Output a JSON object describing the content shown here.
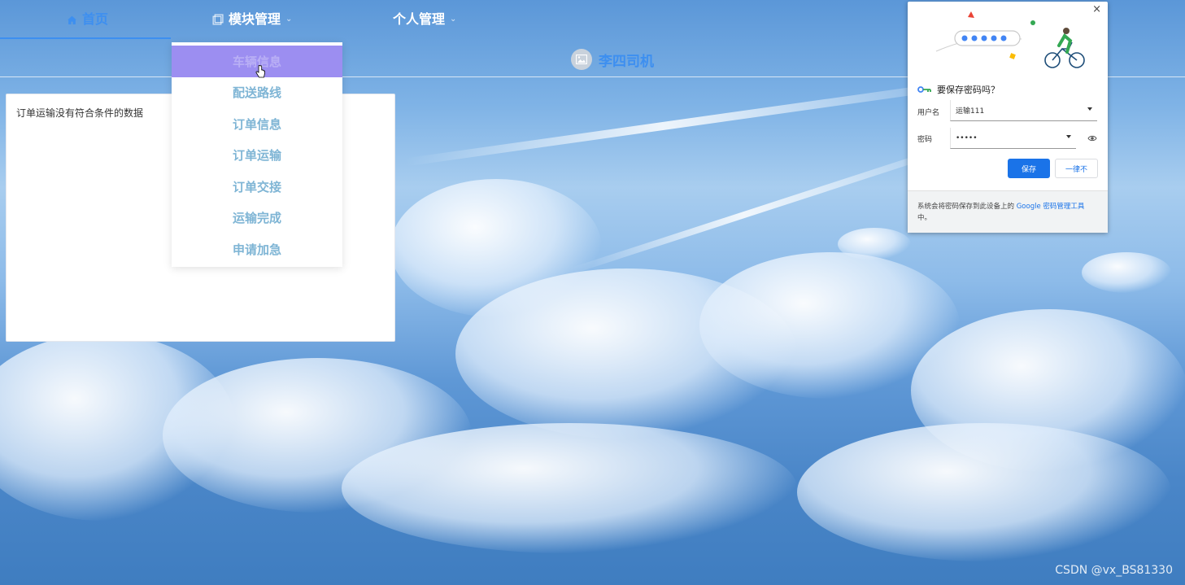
{
  "nav": {
    "home": "首页",
    "modules": "模块管理",
    "personal": "个人管理"
  },
  "user": {
    "name": "李四司机"
  },
  "panel": {
    "message": "订单运输没有符合条件的数据"
  },
  "dropdown": {
    "items": [
      "车辆信息",
      "配送路线",
      "订单信息",
      "订单运输",
      "订单交接",
      "运输完成",
      "申请加急"
    ],
    "hover_index": 0
  },
  "password_popup": {
    "title": "要保存密码吗？",
    "username_label": "用户名",
    "username_value": "运输111",
    "password_label": "密码",
    "password_value": "•••••",
    "save_button": "保存",
    "never_button": "一律不",
    "footer_text": "系统会将密码保存到此设备上的",
    "footer_link": "Google 密码管理工具",
    "footer_suffix": "中。",
    "close": "×"
  },
  "watermark": "CSDN @vx_BS81330",
  "colors": {
    "accent": "#3d8ff0",
    "hover": "#9c8ef1",
    "chrome_blue": "#1a73e8"
  }
}
